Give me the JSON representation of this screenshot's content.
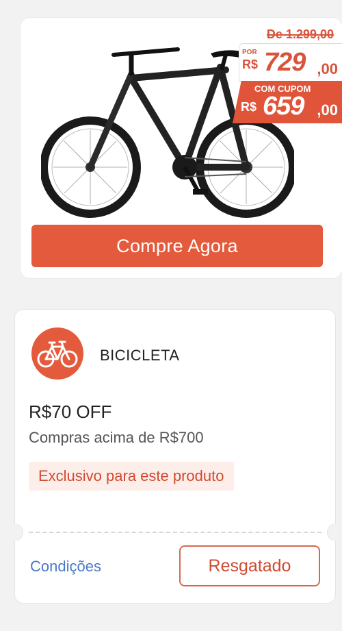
{
  "product": {
    "old_price": "De 1.299,00",
    "por_label": "POR",
    "por_currency": "R$",
    "por_value": "729",
    "por_cents": ",00",
    "cupom_label": "COM CUPOM",
    "cupom_currency": "R$",
    "cupom_value": "659",
    "cupom_cents": ",00",
    "image_icon": "bicycle-product-image",
    "buy_label": "Compre Agora"
  },
  "coupon": {
    "icon": "bicycle-icon",
    "category": "BICICLETA",
    "discount": "R$70 OFF",
    "min_purchase": "Compras acima de R$700",
    "badge": "Exclusivo para este produto",
    "conditions_label": "Condições",
    "redeem_label": "Resgatado"
  },
  "colors": {
    "accent": "#e35b3c",
    "link": "#4a78c8",
    "background": "#f2f2f2"
  }
}
